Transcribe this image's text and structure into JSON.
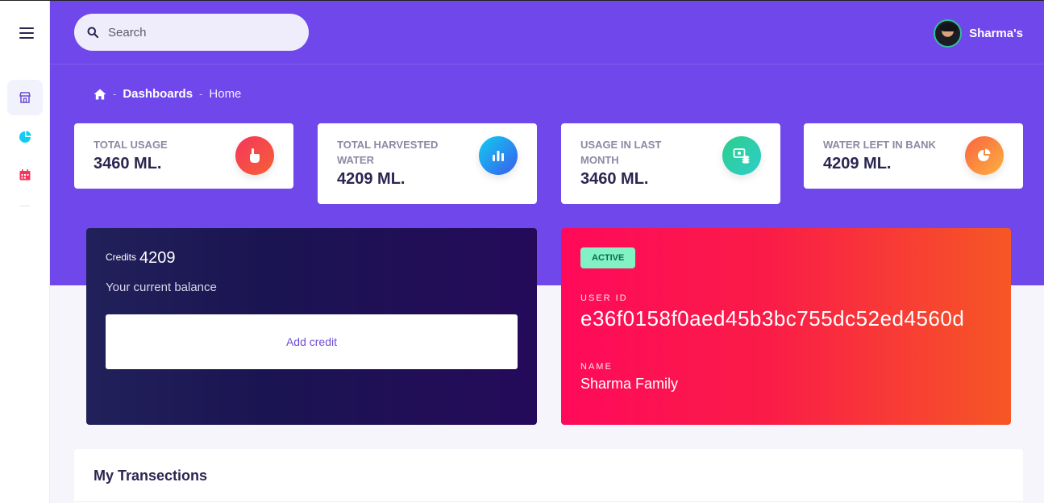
{
  "search": {
    "placeholder": "Search"
  },
  "user": {
    "name": "Sharma's"
  },
  "breadcrumb": {
    "link": "Dashboards",
    "current": "Home",
    "separator": "-"
  },
  "stats": [
    {
      "label": "TOTAL USAGE",
      "value": "3460 ML.",
      "icon": "hand-pointer-icon",
      "color": "#f5365c"
    },
    {
      "label": "TOTAL HARVESTED WATER",
      "value": "4209 ML.",
      "icon": "bar-chart-icon",
      "color": "#1e88e5"
    },
    {
      "label": "USAGE IN LAST MONTH",
      "value": "3460 ML.",
      "icon": "money-coins-icon",
      "color": "#2dce89"
    },
    {
      "label": "WATER LEFT IN BANK",
      "value": "4209 ML.",
      "icon": "pie-chart-icon",
      "color": "#fb6340"
    }
  ],
  "credits": {
    "label": "Credits",
    "value": "4209",
    "subtitle": "Your current balance",
    "button": "Add credit"
  },
  "account": {
    "status": "ACTIVE",
    "user_id_label": "USER ID",
    "user_id": "e36f0158f0aed45b3bc755dc52ed4560d",
    "name_label": "NAME",
    "name": "Sharma Family"
  },
  "transactions": {
    "title": "My Transections"
  },
  "colors": {
    "header": "#7047eb",
    "accent": "#6e4bd8",
    "active_badge": "#82f2c5"
  }
}
